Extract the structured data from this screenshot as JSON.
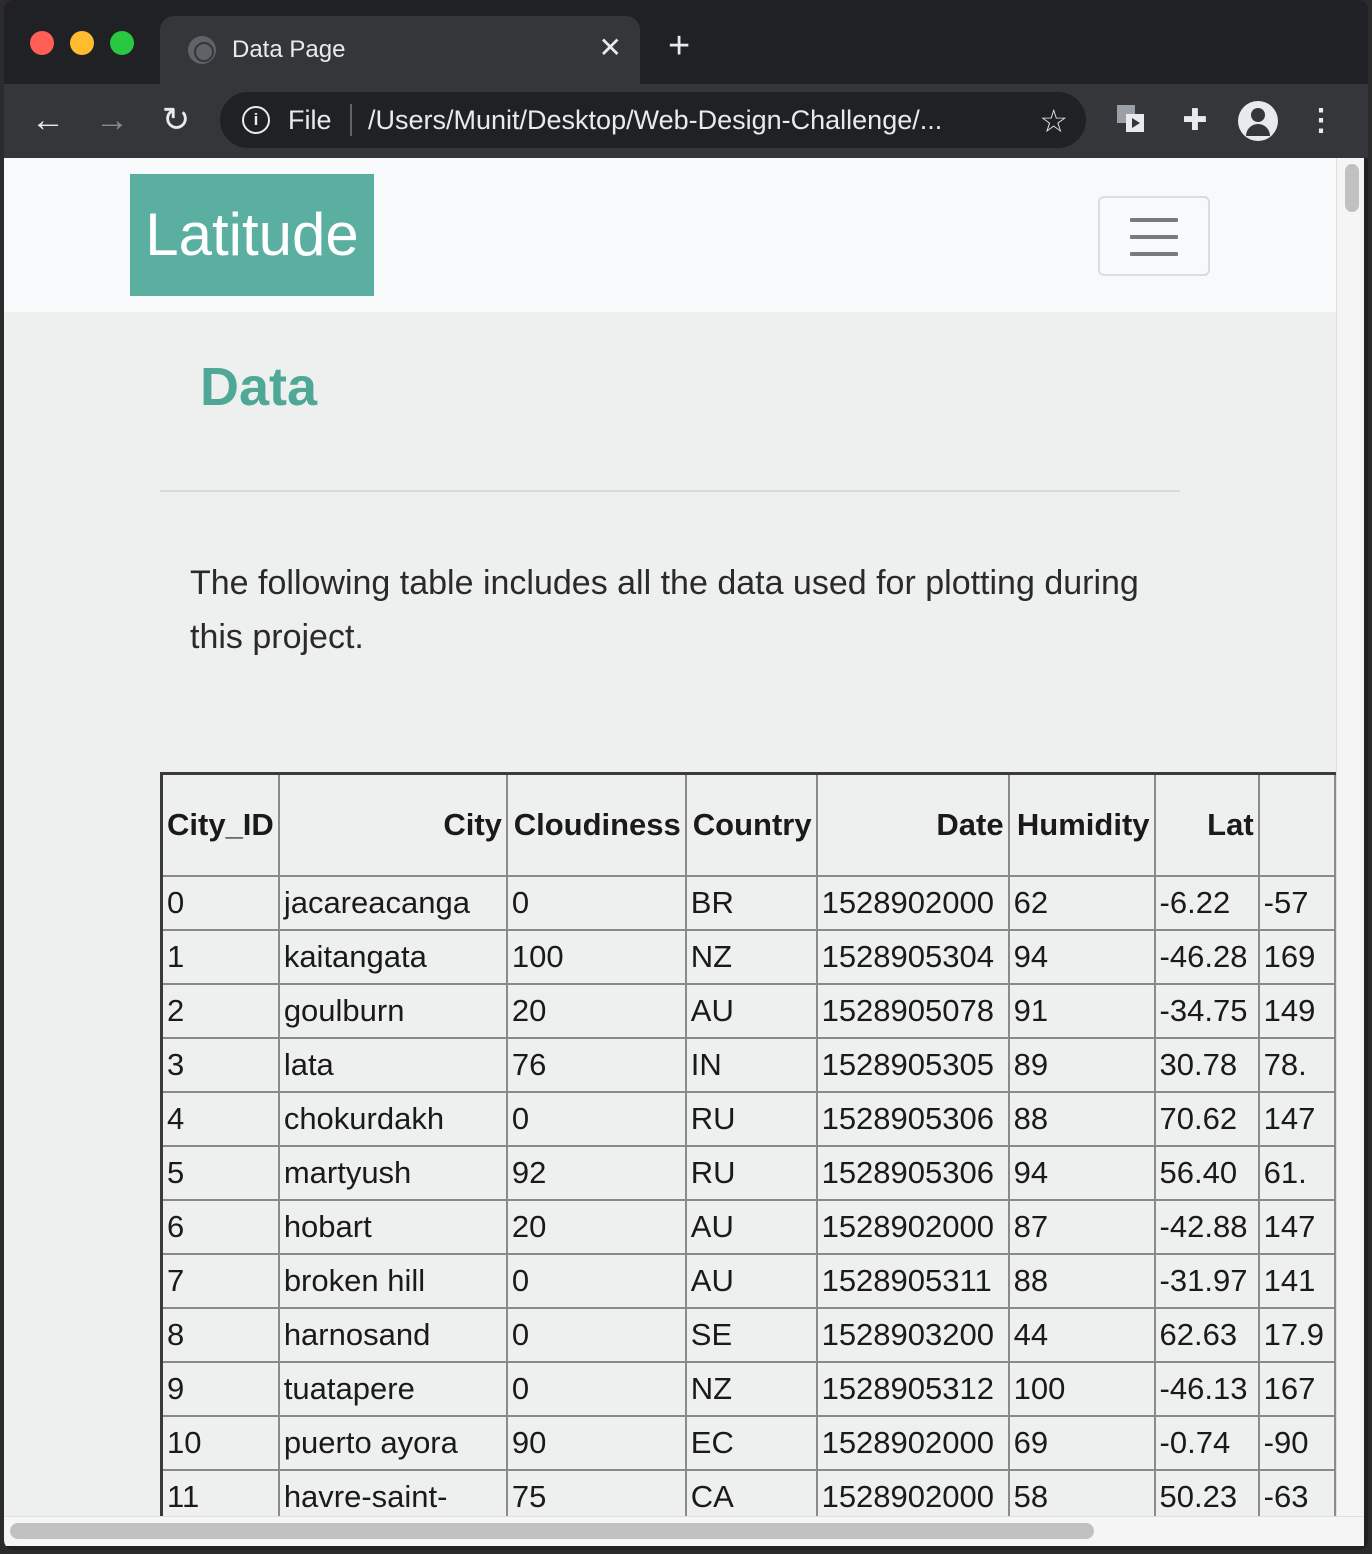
{
  "browser": {
    "tab_title": "Data Page",
    "tab_close": "✕",
    "new_tab": "+",
    "back": "←",
    "forward": "→",
    "reload": "↻",
    "info": "i",
    "scheme": "File",
    "url": "/Users/Munit/Desktop/Web-Design-Challenge/...",
    "star": "☆",
    "puzzle": "✚",
    "menu": "⋮"
  },
  "navbar": {
    "brand": "Latitude"
  },
  "main": {
    "heading": "Data",
    "description": "The following table includes all the data used for plotting during this project."
  },
  "table": {
    "headers": [
      "City_ID",
      "City",
      "Cloudiness",
      "Country",
      "Date",
      "Humidity",
      "Lat",
      ""
    ],
    "rows": [
      [
        "0",
        "jacareacanga",
        "0",
        "BR",
        "1528902000",
        "62",
        "-6.22",
        "-57"
      ],
      [
        "1",
        "kaitangata",
        "100",
        "NZ",
        "1528905304",
        "94",
        "-46.28",
        "169"
      ],
      [
        "2",
        "goulburn",
        "20",
        "AU",
        "1528905078",
        "91",
        "-34.75",
        "149"
      ],
      [
        "3",
        "lata",
        "76",
        "IN",
        "1528905305",
        "89",
        "30.78",
        "78."
      ],
      [
        "4",
        "chokurdakh",
        "0",
        "RU",
        "1528905306",
        "88",
        "70.62",
        "147"
      ],
      [
        "5",
        "martyush",
        "92",
        "RU",
        "1528905306",
        "94",
        "56.40",
        "61."
      ],
      [
        "6",
        "hobart",
        "20",
        "AU",
        "1528902000",
        "87",
        "-42.88",
        "147"
      ],
      [
        "7",
        "broken hill",
        "0",
        "AU",
        "1528905311",
        "88",
        "-31.97",
        "141"
      ],
      [
        "8",
        "harnosand",
        "0",
        "SE",
        "1528903200",
        "44",
        "62.63",
        "17.9"
      ],
      [
        "9",
        "tuatapere",
        "0",
        "NZ",
        "1528905312",
        "100",
        "-46.13",
        "167"
      ],
      [
        "10",
        "puerto ayora",
        "90",
        "EC",
        "1528902000",
        "69",
        "-0.74",
        "-90"
      ],
      [
        "11",
        "havre-saint-",
        "75",
        "CA",
        "1528902000",
        "58",
        "50.23",
        "-63"
      ]
    ]
  },
  "colors": {
    "brand_bg": "#5aafa0",
    "heading": "#4fa897",
    "page_bg": "#eef0ef"
  }
}
